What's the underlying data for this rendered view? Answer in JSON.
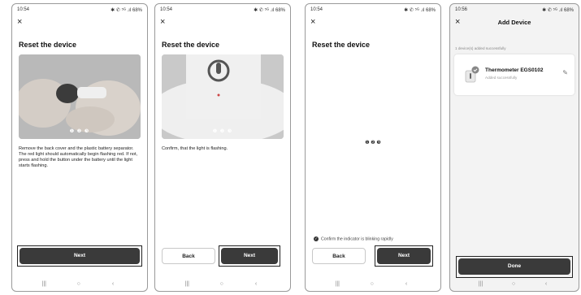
{
  "screens": [
    {
      "status_time": "10:54",
      "status_right": "✱ ✆ ⁵ᴳ .ıl 68%",
      "close_glyph": "×",
      "title": "Reset the device",
      "pager": "❶ ❷ ❸",
      "description": "Remove the back cover and the plastic battery separator. The red light should automatically begin flashing red. If not, press and hold the button under the battery until the light starts flashing.",
      "next_label": "Next"
    },
    {
      "status_time": "10:54",
      "status_right": "✱ ✆ ⁵ᴳ .ıl 68%",
      "close_glyph": "×",
      "title": "Reset the device",
      "pager": "❶ ❷ ❸",
      "description": "Confirm, that the light is flashing.",
      "back_label": "Back",
      "next_label": "Next"
    },
    {
      "status_time": "10:54",
      "status_right": "✱ ✆ ⁵ᴳ .ıl 68%",
      "close_glyph": "×",
      "title": "Reset the device",
      "blink_indicator": "❶ ❷ ❸",
      "confirm_text": "Confirm the indicator is blinking rapidly",
      "back_label": "Back",
      "next_label": "Next"
    },
    {
      "status_time": "10:56",
      "status_right": "✱ ✆ ⁵ᴳ .ıl 68%",
      "close_glyph": "×",
      "title": "Add Device",
      "added_count": "1 device(s) added successfully",
      "device_name": "Thermometer EGS0102",
      "device_status": "Added successfully",
      "done_label": "Done"
    }
  ],
  "nav": {
    "recent": "|||",
    "home": "○",
    "back": "‹"
  },
  "colors": {
    "button_dark": "#3a3a3a",
    "highlight_border": "#222222"
  }
}
